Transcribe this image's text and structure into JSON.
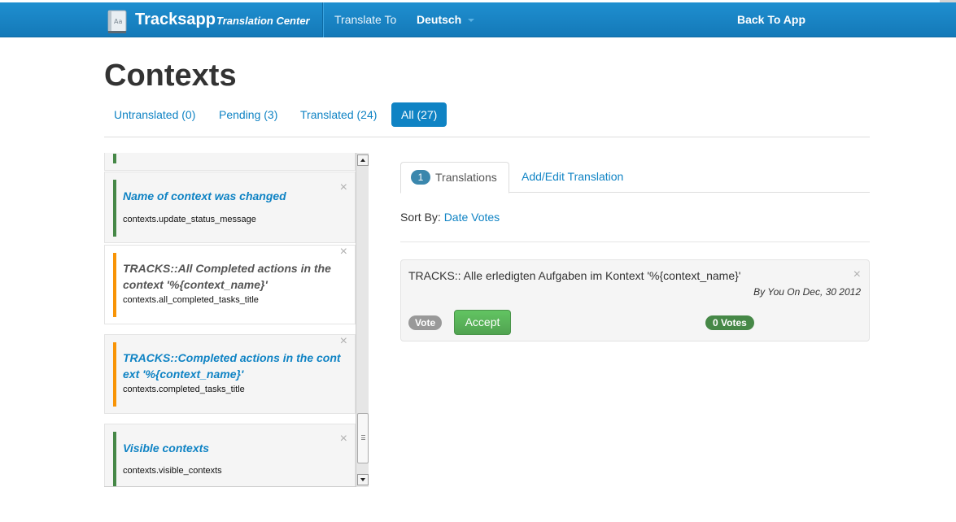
{
  "header": {
    "brand_title": "Tracksapp",
    "brand_subtitle": "Translation Center",
    "translate_to_label": "Translate To",
    "language_selected": "Deutsch",
    "back_link": "Back To App"
  },
  "page": {
    "title": "Contexts",
    "filters": [
      {
        "label": "Untranslated (0)",
        "active": false
      },
      {
        "label": "Pending (3)",
        "active": false
      },
      {
        "label": "Translated (24)",
        "active": false
      },
      {
        "label": "All (27)",
        "active": true
      }
    ]
  },
  "keys_list": {
    "items": [
      {
        "title": "Name of context was changed",
        "key": "contexts.update_status_message",
        "status": "translated",
        "status_color": "#468847"
      },
      {
        "title": "TRACKS::All Completed actions in the context '%{context_name}'",
        "key": "contexts.all_completed_tasks_title",
        "status": "pending",
        "status_color": "#f89406",
        "selected": true
      },
      {
        "title": "TRACKS::Completed actions in the context '%{context_name}'",
        "key": "contexts.completed_tasks_title",
        "status": "pending",
        "status_color": "#f89406"
      },
      {
        "title": "Visible contexts",
        "key": "contexts.visible_contexts",
        "status": "translated",
        "status_color": "#468847"
      }
    ],
    "close_glyph": "×"
  },
  "detail": {
    "tabs": {
      "translations_count": "1",
      "translations_label": "Translations",
      "add_edit_label": "Add/Edit Translation"
    },
    "sort": {
      "label": "Sort By:",
      "options": [
        "Date",
        "Votes"
      ]
    },
    "translation": {
      "text": "TRACKS:: Alle erledigten Aufgaben im Kontext '%{context_name}'",
      "meta": "By You On Dec, 30 2012",
      "vote_label": "Vote",
      "accept_label": "Accept",
      "votes_label": "0 Votes",
      "close_glyph": "×"
    }
  },
  "colors": {
    "topbar": "#1479b8",
    "link": "#0f83c4",
    "translated": "#468847",
    "pending": "#f89406",
    "accept": "#51a351"
  }
}
